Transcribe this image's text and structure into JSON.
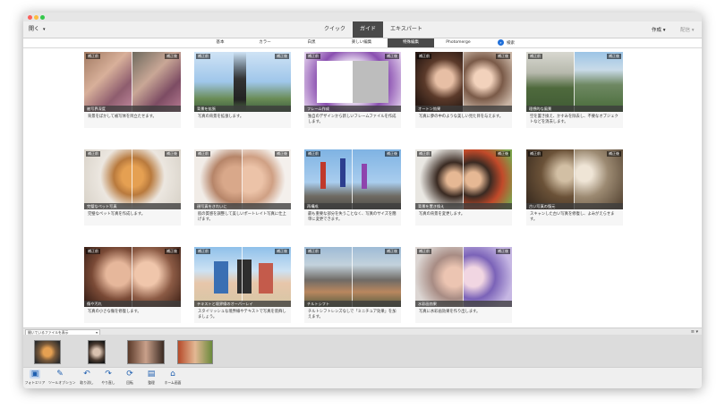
{
  "topbar": {
    "open_label": "開く",
    "modes": [
      "クイック",
      "ガイド",
      "エキスパート"
    ],
    "active_mode": "ガイド",
    "create_label": "作成",
    "share_label": "配信"
  },
  "tabs": {
    "items": [
      "基本",
      "カラー",
      "白黒",
      "楽しい編集",
      "特殊編集",
      "Photomerge"
    ],
    "active": "特殊編集",
    "search_label": "検索"
  },
  "badges": {
    "before": "補正前",
    "after": "補正後"
  },
  "cards": [
    {
      "title": "被写界深度",
      "desc": "背景をぼかして被写体を目立たせます。"
    },
    {
      "title": "背景を拡張",
      "desc": "写真の背景を拡張します。"
    },
    {
      "title": "フレーム作成",
      "desc": "独自のデザインから新しいフレームファイルを作成します。"
    },
    {
      "title": "オートン効果",
      "desc": "写真に夢の中のような美しい見た目を与えます。"
    },
    {
      "title": "理想的な風景",
      "desc": "空を置き換え、かすみを除去し、不要なオブジェクトなどを消去します。"
    },
    {
      "title": "完璧なペット写真",
      "desc": "完璧なペット写真を作成します。"
    },
    {
      "title": "顔写真をきれいに",
      "desc": "肌の質感を調整して美しいポートレイト写真に仕上げます。"
    },
    {
      "title": "再構成",
      "desc": "最も重要な部分を失うことなく、写真のサイズを簡単に変更できます。"
    },
    {
      "title": "背景を置き換え",
      "desc": "写真の背景を変更します。"
    },
    {
      "title": "古い写真の復元",
      "desc": "スキャンした古い写真を修復し、よみがえらせます。"
    },
    {
      "title": "傷や汚れ",
      "desc": "写真の小さな傷を修復します。"
    },
    {
      "title": "テキストと境界線のオーバーレイ",
      "desc": "スタイリッシュな境界線やテキストで写真を装飾しましょう。"
    },
    {
      "title": "チルトシフト",
      "desc": "チルトシフトレンズなしで「ミニチュア効果」を加えます。"
    },
    {
      "title": "水彩画効果",
      "desc": "写真に水彩画効果を作り出します。"
    }
  ],
  "bin": {
    "selector_label": "開いているファイルを表示"
  },
  "bottom_tools": [
    {
      "label": "フォトエリア",
      "icon": "photo-bin-icon"
    },
    {
      "label": "ツールオプション",
      "icon": "tool-options-icon"
    },
    {
      "label": "取り消し",
      "icon": "undo-icon"
    },
    {
      "label": "やり直し",
      "icon": "redo-icon"
    },
    {
      "label": "回転",
      "icon": "rotate-icon"
    },
    {
      "label": "整理",
      "icon": "organize-icon"
    },
    {
      "label": "ホーム画面",
      "icon": "home-icon"
    }
  ],
  "colors": {
    "active_tab": "#4a4a4a",
    "accent": "#1f6fd9"
  }
}
